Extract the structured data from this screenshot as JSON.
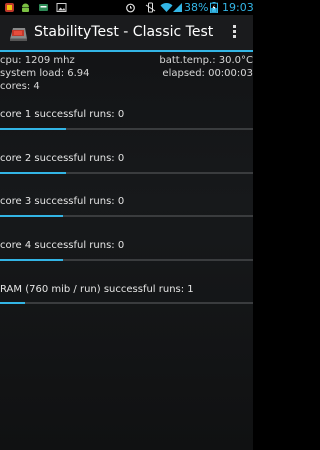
{
  "status_bar": {
    "battery_percent": "38%",
    "time": "19:03",
    "icons": [
      "app-notification-icon",
      "android-notification-icon",
      "card-icon",
      "image-icon",
      "alarm-icon",
      "vibrate-icon",
      "wifi-icon",
      "signal-icon",
      "battery-charging-icon"
    ]
  },
  "action_bar": {
    "title": "StabilityTest - Classic Test",
    "app_icon": "stabilitytest-app-icon",
    "menu_icon": "overflow-menu-icon"
  },
  "stats": {
    "cpu": "cpu: 1209 mhz",
    "batt_temp": "batt.temp.: 30.0°C",
    "system_load": "system load: 6.94",
    "elapsed": "elapsed: 00:00:03",
    "cores": "cores: 4"
  },
  "tests": [
    {
      "label": "core 1 successful runs: 0",
      "progress": 0.26
    },
    {
      "label": "core 2 successful runs: 0",
      "progress": 0.26
    },
    {
      "label": "core 3 successful runs: 0",
      "progress": 0.25
    },
    {
      "label": "core 4 successful runs: 0",
      "progress": 0.25
    },
    {
      "label": "RAM (760 mib / run) successful runs: 1",
      "progress": 0.1
    }
  ],
  "colors": {
    "accent": "#33b5e5",
    "track": "#3a3c3e",
    "text": "#e6e6e6"
  }
}
